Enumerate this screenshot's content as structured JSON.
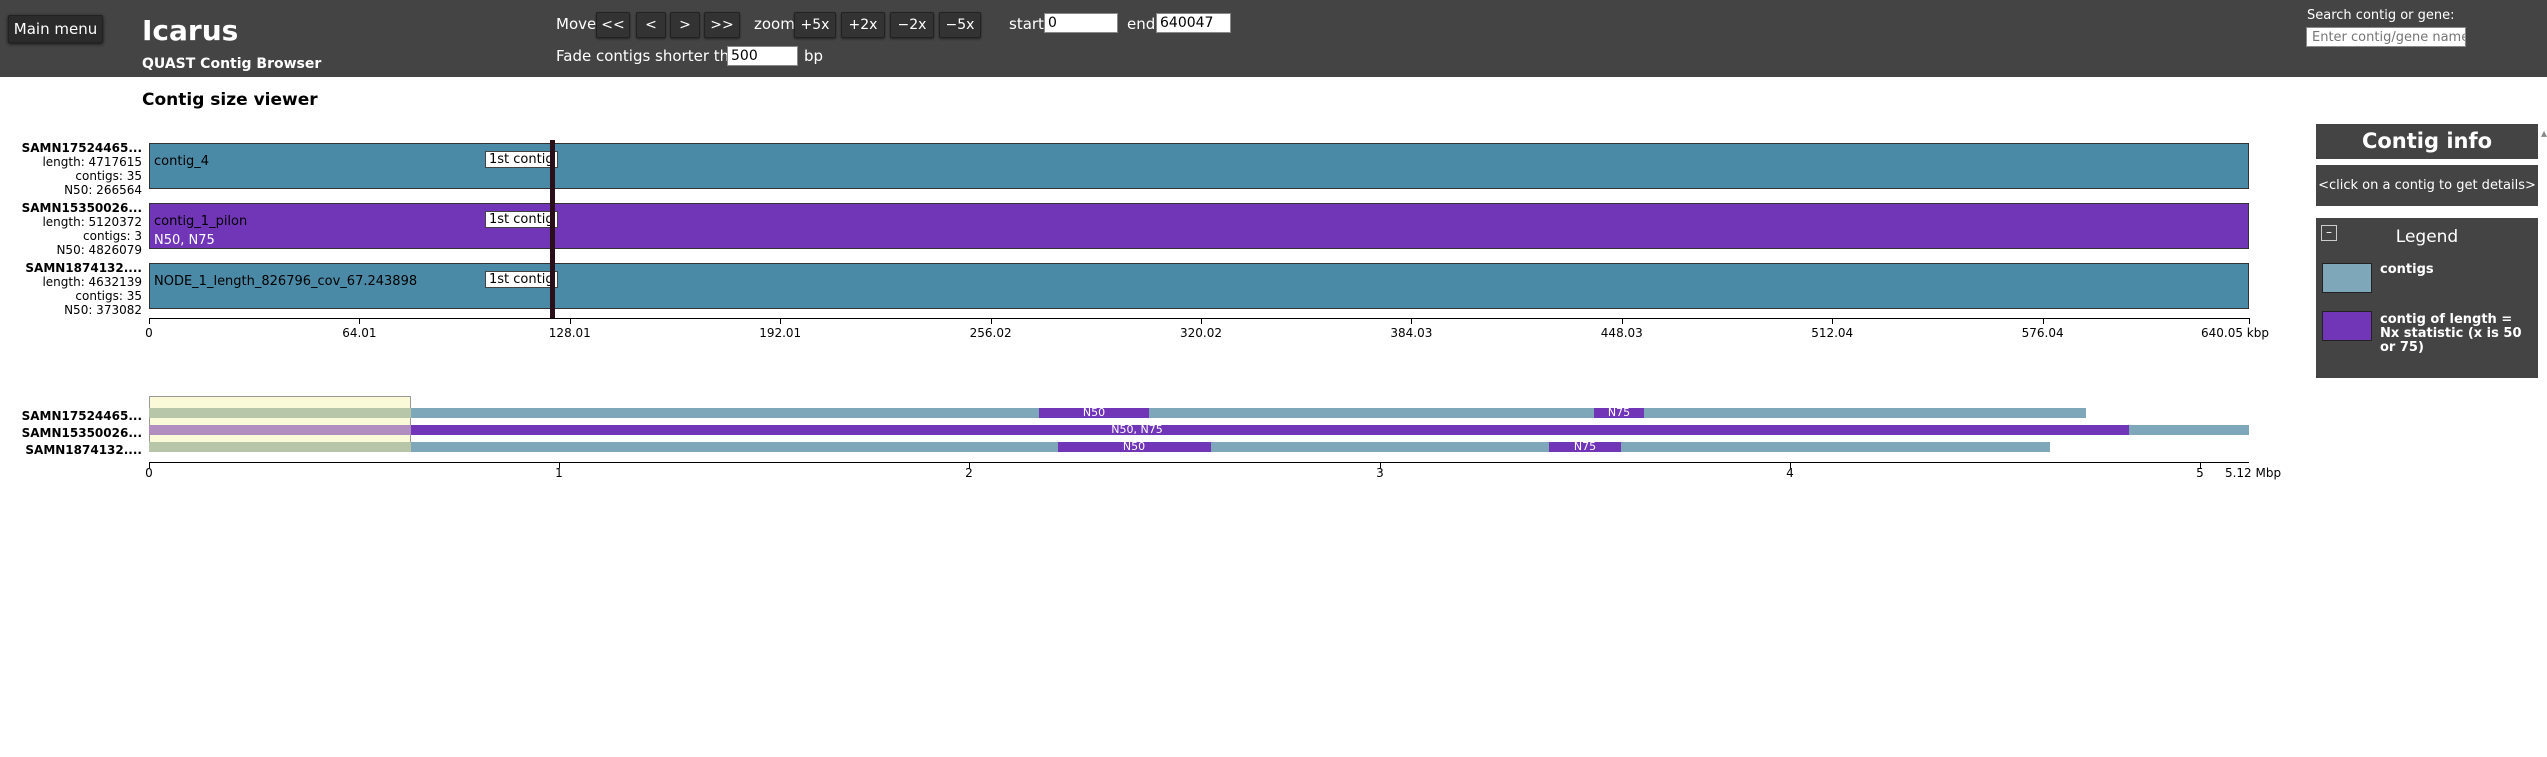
{
  "header": {
    "main_menu": "Main menu",
    "app_title": "Icarus",
    "app_subtitle": "QUAST Contig Browser",
    "move_label": "Move",
    "move_buttons": [
      "<<",
      "<",
      ">",
      ">>"
    ],
    "zoom_label": "zoom",
    "zoom_buttons": [
      "+5x",
      "+2x",
      "−2x",
      "−5x"
    ],
    "start_label": "start",
    "start_value": "0",
    "end_label": "end",
    "end_value": "640047",
    "fade_label": "Fade contigs shorter than",
    "fade_value": "500",
    "fade_unit": "bp",
    "search_label": "Search contig or gene:",
    "search_placeholder": "Enter contig/gene name"
  },
  "viewer": {
    "title": "Contig size viewer",
    "genomes": [
      {
        "name": "SAMN17524465...",
        "length": "length: 4717615",
        "contigs": "contigs: 35",
        "n50": "N50: 266564",
        "contig_name": "contig_4",
        "contig_sub": "",
        "tag": "1st contig",
        "color": "#4b8aa6"
      },
      {
        "name": "SAMN15350026...",
        "length": "length: 5120372",
        "contigs": "contigs: 3",
        "n50": "N50: 4826079",
        "contig_name": "contig_1_pilon",
        "contig_sub": "N50, N75",
        "tag": "1st contig",
        "color": "#7135b8"
      },
      {
        "name": "SAMN1874132....",
        "length": "length: 4632139",
        "contigs": "contigs: 35",
        "n50": "N50: 373082",
        "contig_name": "NODE_1_length_826796_cov_67.243898",
        "contig_sub": "",
        "tag": "1st contig",
        "color": "#4b8aa6"
      }
    ],
    "axis_ticks": [
      "0",
      "64.01",
      "128.01",
      "192.01",
      "256.02",
      "320.02",
      "384.03",
      "448.03",
      "512.04",
      "576.04",
      "640.05 kbp"
    ]
  },
  "overview": {
    "rows": [
      {
        "name": "SAMN17524465...",
        "labels": [
          "N50",
          "N75"
        ]
      },
      {
        "name": "SAMN15350026...",
        "labels": [
          "N50, N75"
        ]
      },
      {
        "name": "SAMN1874132....",
        "labels": [
          "N50",
          "N75"
        ]
      }
    ],
    "axis_ticks": [
      "0",
      "1",
      "2",
      "3",
      "4",
      "5",
      "5.12 Mbp"
    ]
  },
  "info_panel": {
    "title": "Contig info",
    "hint": "<click on a contig to get details>"
  },
  "legend": {
    "title": "Legend",
    "toggle": "–",
    "items": [
      {
        "label": "contigs",
        "color": "#7fa7ba"
      },
      {
        "label": "contig of length = Nx statistic (x is 50 or 75)",
        "color": "#7135b8"
      }
    ]
  }
}
